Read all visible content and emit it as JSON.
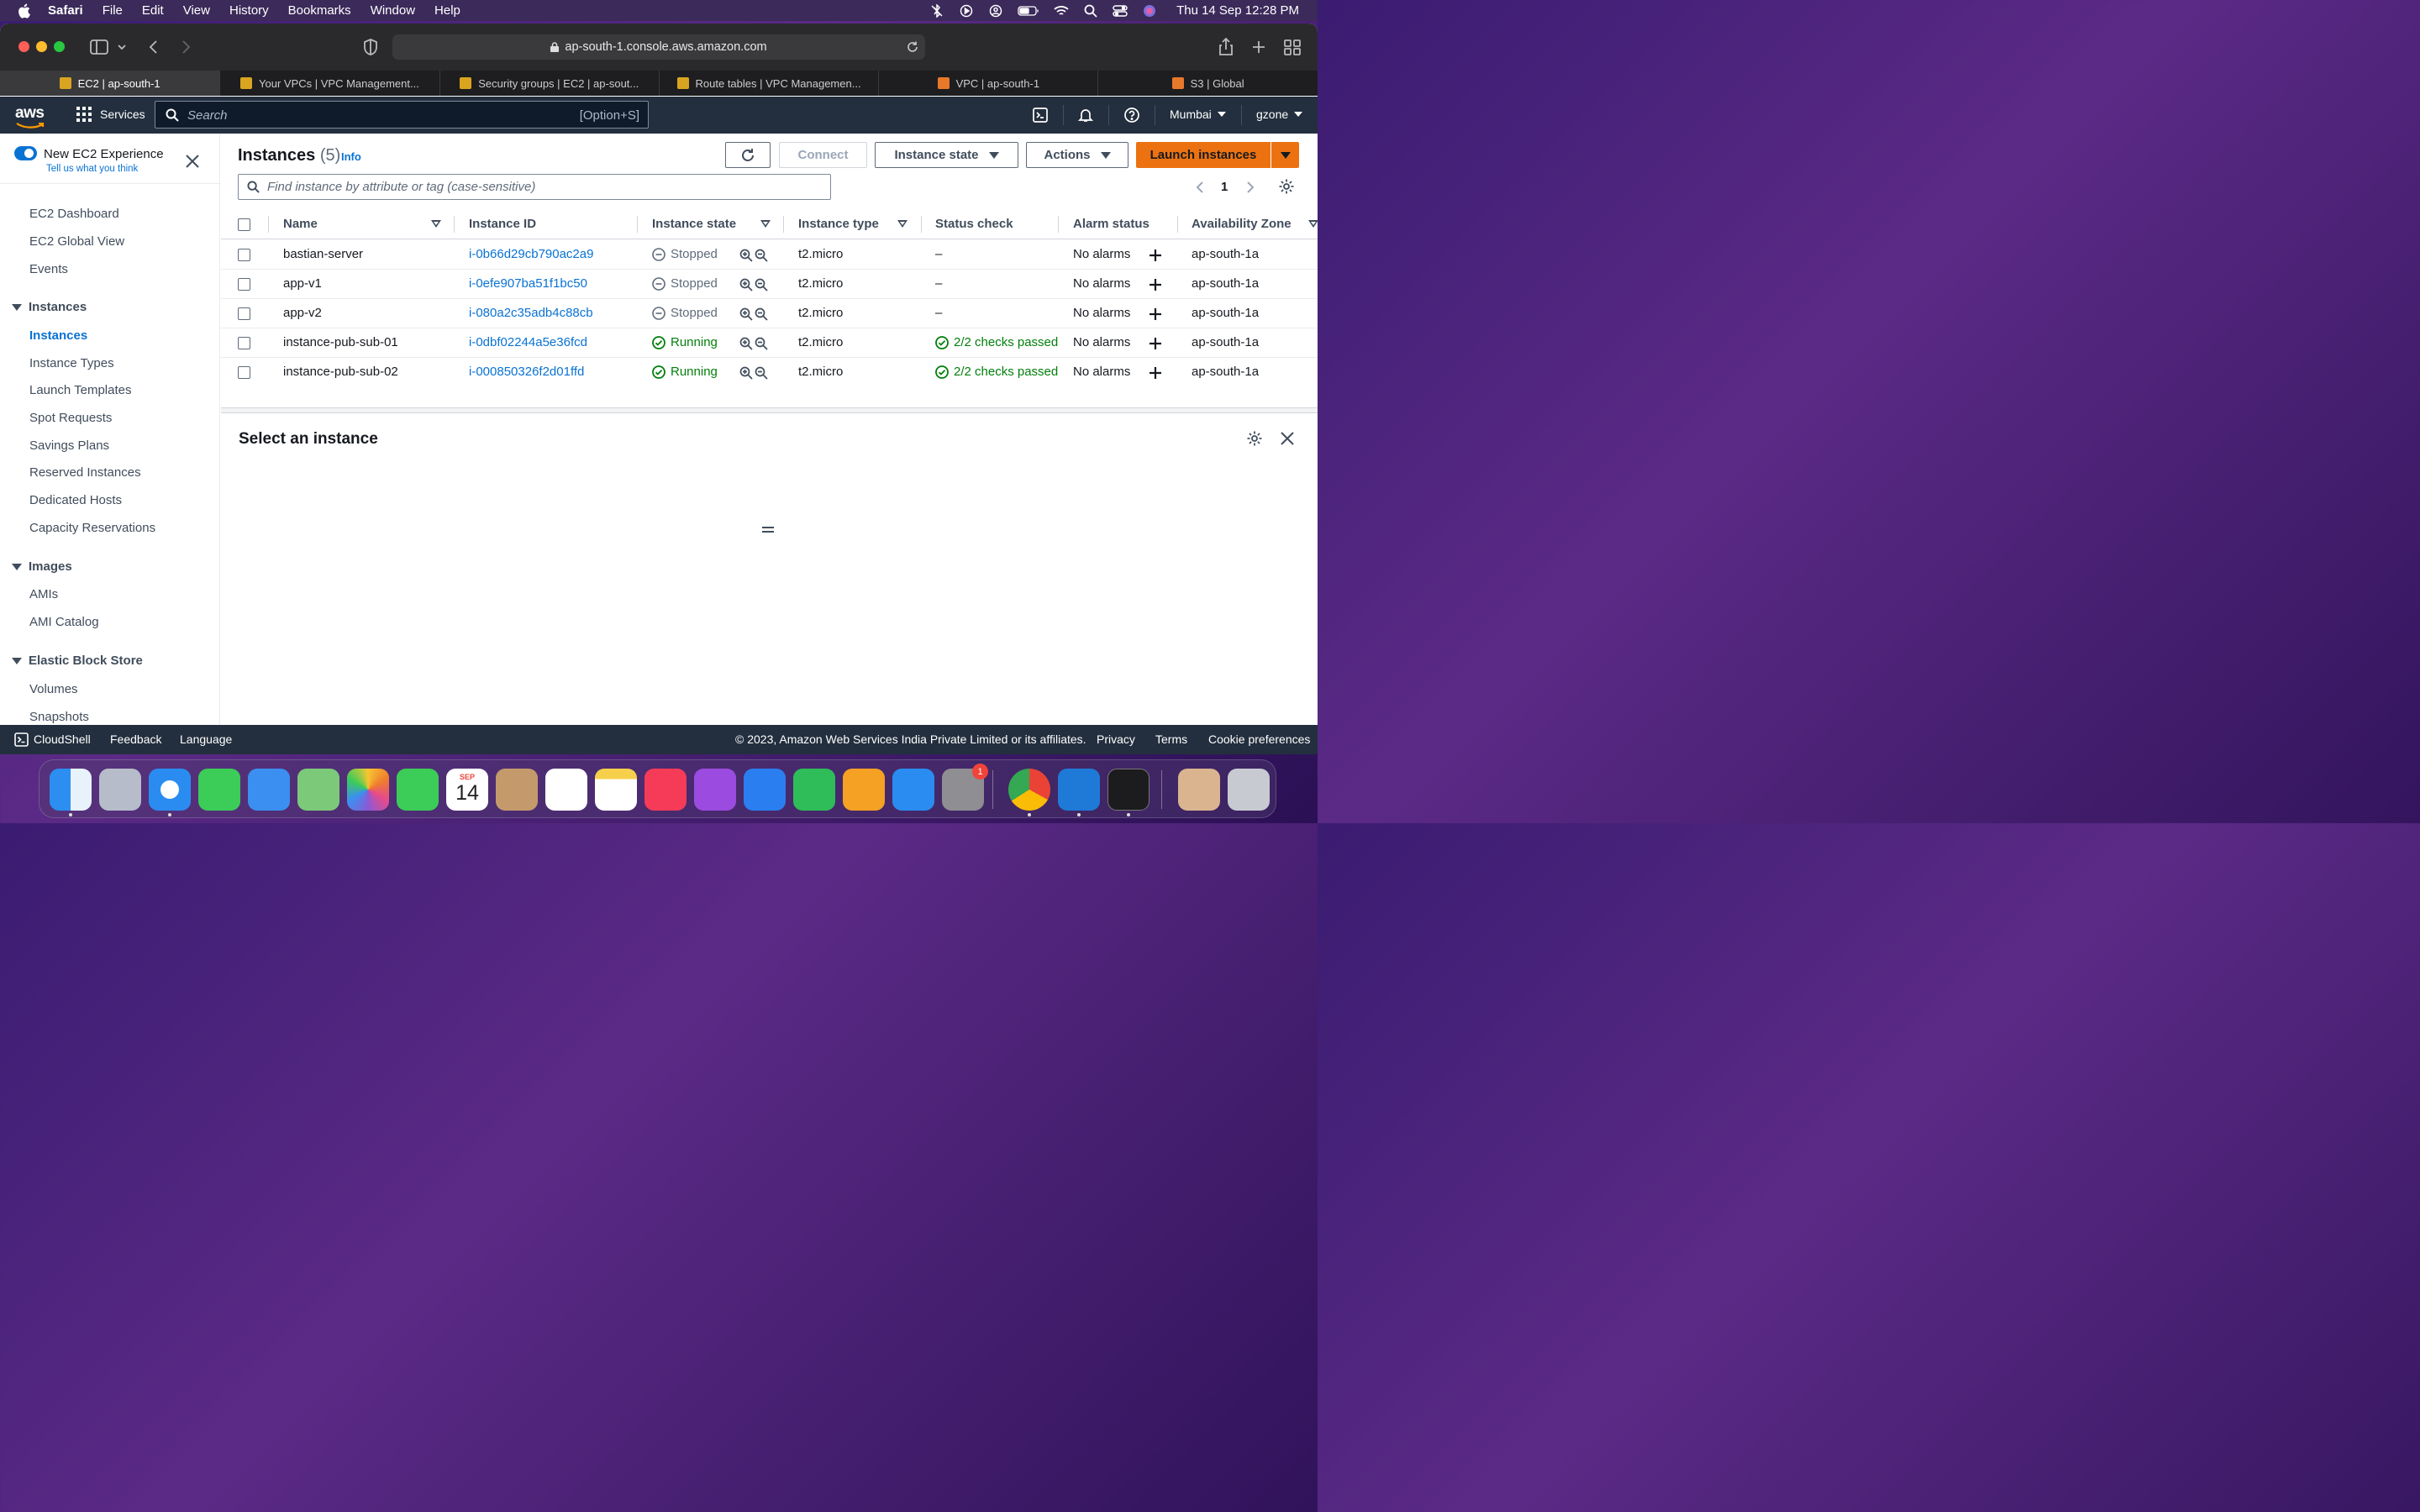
{
  "menubar": {
    "app": "Safari",
    "items": [
      "File",
      "Edit",
      "View",
      "History",
      "Bookmarks",
      "Window",
      "Help"
    ],
    "datetime": "Thu 14 Sep  12:28 PM"
  },
  "browser": {
    "url": "ap-south-1.console.aws.amazon.com",
    "tabs": [
      {
        "label": "EC2 | ap-south-1",
        "active": true
      },
      {
        "label": "Your VPCs | VPC Management...",
        "active": false
      },
      {
        "label": "Security groups | EC2 | ap-sout...",
        "active": false
      },
      {
        "label": "Route tables | VPC Managemen...",
        "active": false
      },
      {
        "label": "VPC | ap-south-1",
        "active": false
      },
      {
        "label": "S3 | Global",
        "active": false
      }
    ]
  },
  "awsnav": {
    "logo": "aws",
    "services": "Services",
    "search_placeholder": "Search",
    "search_shortcut": "[Option+S]",
    "region": "Mumbai",
    "user": "gzone"
  },
  "sidebar": {
    "new_experience": "New EC2 Experience",
    "tell_us": "Tell us what you think",
    "top_items": [
      "EC2 Dashboard",
      "EC2 Global View",
      "Events"
    ],
    "sections": [
      {
        "title": "Instances",
        "items": [
          "Instances",
          "Instance Types",
          "Launch Templates",
          "Spot Requests",
          "Savings Plans",
          "Reserved Instances",
          "Dedicated Hosts",
          "Capacity Reservations"
        ]
      },
      {
        "title": "Images",
        "items": [
          "AMIs",
          "AMI Catalog"
        ]
      },
      {
        "title": "Elastic Block Store",
        "items": [
          "Volumes",
          "Snapshots"
        ]
      }
    ],
    "active_item": "Instances"
  },
  "instances": {
    "title": "Instances",
    "count": "(5)",
    "info": "Info",
    "buttons": {
      "connect": "Connect",
      "instance_state": "Instance state",
      "actions": "Actions",
      "launch": "Launch instances"
    },
    "filter_placeholder": "Find instance by attribute or tag (case-sensitive)",
    "page": "1",
    "columns": [
      "Name",
      "Instance ID",
      "Instance state",
      "Instance type",
      "Status check",
      "Alarm status",
      "Availability Zone"
    ],
    "rows": [
      {
        "name": "bastian-server",
        "id": "i-0b66d29cb790ac2a9",
        "state": "Stopped",
        "type": "t2.micro",
        "status": "–",
        "alarm": "No alarms",
        "az": "ap-south-1a"
      },
      {
        "name": "app-v1",
        "id": "i-0efe907ba51f1bc50",
        "state": "Stopped",
        "type": "t2.micro",
        "status": "–",
        "alarm": "No alarms",
        "az": "ap-south-1a"
      },
      {
        "name": "app-v2",
        "id": "i-080a2c35adb4c88cb",
        "state": "Stopped",
        "type": "t2.micro",
        "status": "–",
        "alarm": "No alarms",
        "az": "ap-south-1a"
      },
      {
        "name": "instance-pub-sub-01",
        "id": "i-0dbf02244a5e36fcd",
        "state": "Running",
        "type": "t2.micro",
        "status": "2/2 checks passed",
        "alarm": "No alarms",
        "az": "ap-south-1a"
      },
      {
        "name": "instance-pub-sub-02",
        "id": "i-000850326f2d01ffd",
        "state": "Running",
        "type": "t2.micro",
        "status": "2/2 checks passed",
        "alarm": "No alarms",
        "az": "ap-south-1a"
      }
    ]
  },
  "detail": {
    "title": "Select an instance"
  },
  "footer": {
    "cloudshell": "CloudShell",
    "feedback": "Feedback",
    "language": "Language",
    "copyright": "© 2023, Amazon Web Services India Private Limited or its affiliates.",
    "privacy": "Privacy",
    "terms": "Terms",
    "cookies": "Cookie preferences"
  },
  "dock": {
    "calendar_month": "SEP",
    "calendar_day": "14",
    "settings_badge": "1",
    "apps": [
      "finder",
      "launchpad",
      "safari",
      "messages",
      "mail",
      "maps",
      "photos",
      "facetime",
      "calendar",
      "contacts",
      "reminders",
      "notes",
      "music",
      "podcasts",
      "keynote",
      "numbers",
      "pages",
      "app-store",
      "system-settings",
      "chrome",
      "vscode",
      "terminal",
      "archive",
      "trash"
    ]
  },
  "colors": {
    "aws_nav": "#232f3e",
    "link": "#0972d3",
    "launch_button": "#ec7211",
    "running": "#037f0c",
    "stopped": "#5f6b7a"
  }
}
